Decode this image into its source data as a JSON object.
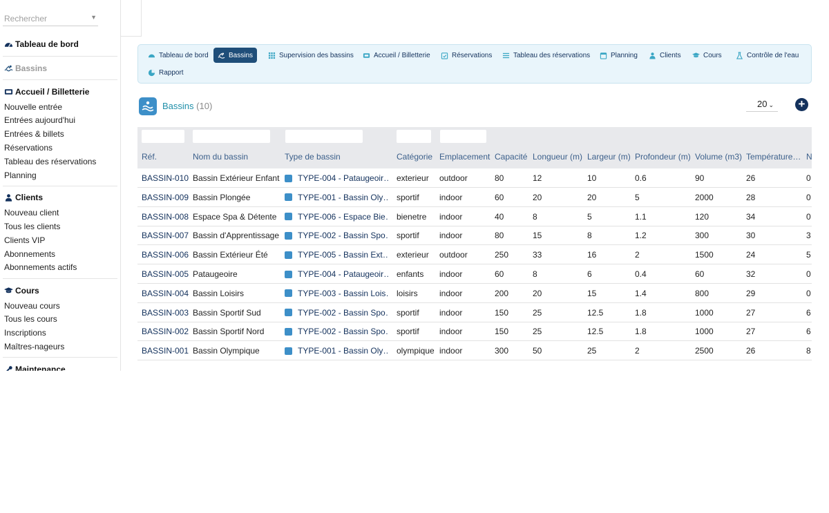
{
  "search": {
    "placeholder": "Rechercher"
  },
  "sidebar": {
    "dashboard": "Tableau de bord",
    "pools": "Bassins",
    "reception": {
      "title": "Accueil / Billetterie",
      "items": [
        "Nouvelle entrée",
        "Entrées aujourd'hui",
        "Entrées & billets",
        "Réservations",
        "Tableau des réservations",
        "Planning"
      ]
    },
    "clients": {
      "title": "Clients",
      "items": [
        "Nouveau client",
        "Tous les clients",
        "Clients VIP",
        "Abonnements",
        "Abonnements actifs"
      ]
    },
    "courses": {
      "title": "Cours",
      "items": [
        "Nouveau cours",
        "Tous les cours",
        "Inscriptions",
        "Maîtres-nageurs"
      ]
    },
    "maintenance": "Maintenance"
  },
  "nav": {
    "tabs": [
      "Tableau de bord",
      "Bassins",
      "Supervision des bassins",
      "Accueil / Billetterie",
      "Réservations",
      "Tableau des réservations",
      "Planning",
      "Clients",
      "Cours",
      "Contrôle de l'eau",
      "Rapport"
    ],
    "active_index": 1
  },
  "list": {
    "title": "Bassins",
    "count": "(10)",
    "per_page": "20"
  },
  "table": {
    "columns": [
      "Réf.",
      "Nom du bassin",
      "Type de bassin",
      "Catégorie",
      "Emplacement",
      "Capacité",
      "Longueur (m)",
      "Largeur (m)",
      "Profondeur (m)",
      "Volume (m3)",
      "Température…",
      "N"
    ],
    "rows": [
      [
        "BASSIN-010",
        "Bassin Extérieur Enfants",
        "TYPE-004 - Pataugeoir…",
        "exterieur",
        "outdoor",
        "80",
        "12",
        "10",
        "0.6",
        "90",
        "26",
        "0"
      ],
      [
        "BASSIN-009",
        "Bassin Plongée",
        "TYPE-001 - Bassin Oly…",
        "sportif",
        "indoor",
        "60",
        "20",
        "20",
        "5",
        "2000",
        "28",
        "0"
      ],
      [
        "BASSIN-008",
        "Espace Spa & Détente",
        "TYPE-006 - Espace Bie…",
        "bienetre",
        "indoor",
        "40",
        "8",
        "5",
        "1.1",
        "120",
        "34",
        "0"
      ],
      [
        "BASSIN-007",
        "Bassin d'Apprentissage",
        "TYPE-002 - Bassin Spo…",
        "sportif",
        "indoor",
        "80",
        "15",
        "8",
        "1.2",
        "300",
        "30",
        "3"
      ],
      [
        "BASSIN-006",
        "Bassin Extérieur Été",
        "TYPE-005 - Bassin Ext…",
        "exterieur",
        "outdoor",
        "250",
        "33",
        "16",
        "2",
        "1500",
        "24",
        "5"
      ],
      [
        "BASSIN-005",
        "Pataugeoire",
        "TYPE-004 - Pataugeoir…",
        "enfants",
        "indoor",
        "60",
        "8",
        "6",
        "0.4",
        "60",
        "32",
        "0"
      ],
      [
        "BASSIN-004",
        "Bassin Loisirs",
        "TYPE-003 - Bassin Lois…",
        "loisirs",
        "indoor",
        "200",
        "20",
        "15",
        "1.4",
        "800",
        "29",
        "0"
      ],
      [
        "BASSIN-003",
        "Bassin Sportif Sud",
        "TYPE-002 - Bassin Spo…",
        "sportif",
        "indoor",
        "150",
        "25",
        "12.5",
        "1.8",
        "1000",
        "27",
        "6"
      ],
      [
        "BASSIN-002",
        "Bassin Sportif Nord",
        "TYPE-002 - Bassin Spo…",
        "sportif",
        "indoor",
        "150",
        "25",
        "12.5",
        "1.8",
        "1000",
        "27",
        "6"
      ],
      [
        "BASSIN-001",
        "Bassin Olympique",
        "TYPE-001 - Bassin Oly…",
        "olympique",
        "indoor",
        "300",
        "50",
        "25",
        "2",
        "2500",
        "26",
        "8"
      ]
    ]
  },
  "colors": {
    "accent": "#1f4e79",
    "link": "#13315c",
    "nav_bg": "#e9f5fb",
    "title": "#1f8fa9"
  }
}
